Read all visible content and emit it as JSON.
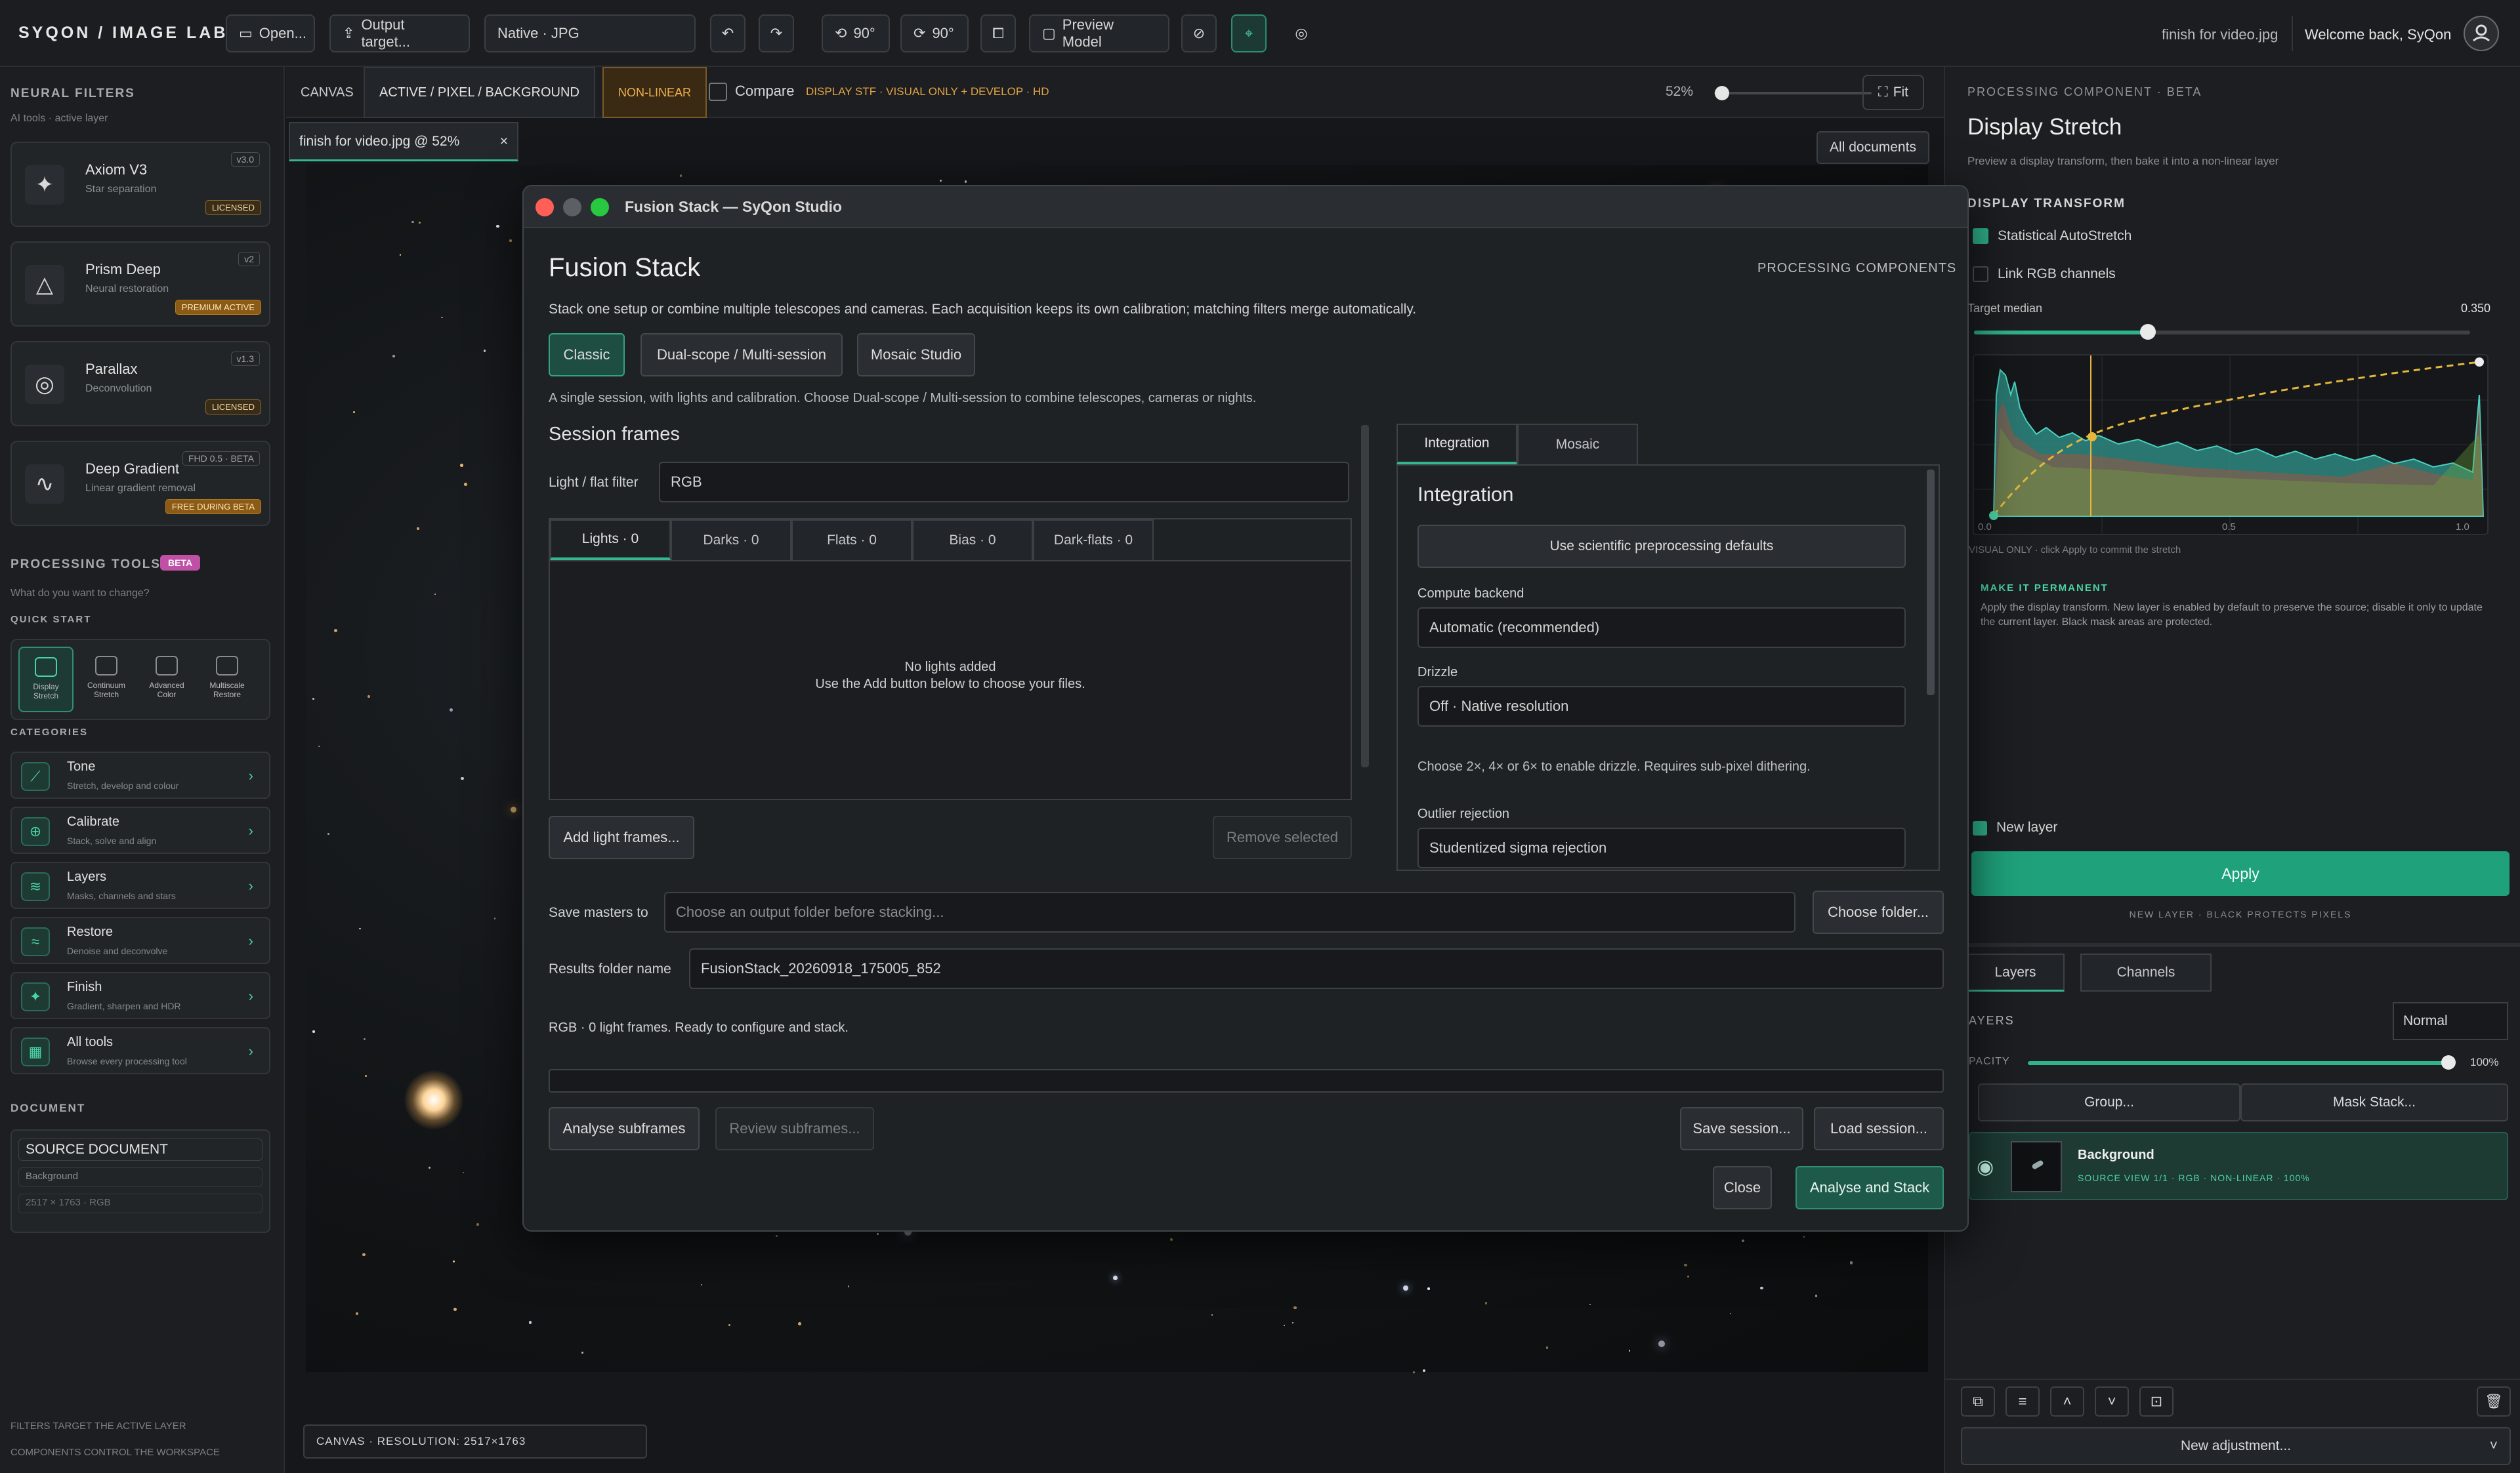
{
  "topbar": {
    "brand": "SYQON / IMAGE LAB",
    "open": "Open...",
    "output_target": "Output target...",
    "format": "Native · JPG",
    "rotate_left": "90°",
    "rotate_right": "90°",
    "preview_model": "Preview Model",
    "filename": "finish for video.jpg",
    "welcome": "Welcome back, SyQon"
  },
  "left": {
    "neural_title": "NEURAL FILTERS",
    "neural_sub": "AI tools · active layer",
    "filters": [
      {
        "name": "Axiom V3",
        "desc": "Star separation",
        "version": "v3.0",
        "badge": "LICENSED"
      },
      {
        "name": "Prism Deep",
        "desc": "Neural restoration",
        "version": "v2",
        "badge": "PREMIUM ACTIVE"
      },
      {
        "name": "Parallax",
        "desc": "Deconvolution",
        "version": "v1.3",
        "badge": "LICENSED"
      },
      {
        "name": "Deep Gradient",
        "desc": "Linear gradient removal",
        "version": "FHD 0.5 · BETA",
        "badge": "FREE DURING BETA"
      }
    ],
    "tools_title": "PROCESSING TOOLS",
    "tools_badge": "BETA",
    "tools_sub": "What do you want to change?",
    "quick_start": "QUICK START",
    "quick": [
      {
        "l1": "Display",
        "l2": "Stretch"
      },
      {
        "l1": "Continuum",
        "l2": "Stretch"
      },
      {
        "l1": "Advanced",
        "l2": "Color"
      },
      {
        "l1": "Multiscale",
        "l2": "Restore"
      }
    ],
    "categories_title": "CATEGORIES",
    "categories": [
      {
        "name": "Tone",
        "desc": "Stretch, develop and colour"
      },
      {
        "name": "Calibrate",
        "desc": "Stack, solve and align"
      },
      {
        "name": "Layers",
        "desc": "Masks, channels and stars"
      },
      {
        "name": "Restore",
        "desc": "Denoise and deconvolve"
      },
      {
        "name": "Finish",
        "desc": "Gradient, sharpen and HDR"
      },
      {
        "name": "All tools",
        "desc": "Browse every processing tool"
      }
    ],
    "document_title": "DOCUMENT",
    "source_document": "SOURCE DOCUMENT",
    "doc_layer": "Background",
    "doc_size": "2517 × 1763  ·  RGB",
    "footer1": "FILTERS TARGET THE ACTIVE LAYER",
    "footer2": "COMPONENTS CONTROL THE WORKSPACE"
  },
  "canvas": {
    "canvas_label": "CANVAS",
    "path": "ACTIVE / PIXEL / BACKGROUND",
    "nonlinear": "NON-LINEAR",
    "compare": "Compare",
    "display_stf": "DISPLAY STF · VISUAL ONLY + DEVELOP · HD",
    "zoom": "52%",
    "zoom_fraction": 0.05,
    "fit": "Fit",
    "doc_tab": "finish for video.jpg @ 52%",
    "all_documents": "All documents",
    "status": "CANVAS  ·  RESOLUTION: 2517×1763"
  },
  "right": {
    "component_label": "PROCESSING COMPONENT · BETA",
    "title": "Display Stretch",
    "subtitle": "Preview a display transform, then bake it into a non-linear layer",
    "transform_title": "DISPLAY TRANSFORM",
    "auto_stretch": "Statistical AutoStretch",
    "link_rgb": "Link RGB channels",
    "target_median": "Target median",
    "target_median_value": "0.350",
    "target_median_fraction": 0.35,
    "axis_ticks": [
      "0.0",
      "0.5",
      "1.0"
    ],
    "visual_only": "VISUAL ONLY · click Apply to commit the stretch",
    "make_permanent": "MAKE IT PERMANENT",
    "permanent_desc": "Apply the display transform. New layer is enabled by default to preserve the source; disable it only to update the current layer. Black mask areas are protected.",
    "new_layer": "New layer",
    "apply": "Apply",
    "new_layer_note": "NEW LAYER · BLACK PROTECTS PIXELS",
    "tab_layers": "Layers",
    "tab_channels": "Channels",
    "layers_title": "AYERS",
    "blend": "Normal",
    "opacity_label": "PACITY",
    "opacity_value": "100%",
    "group": "Group...",
    "mask_stack": "Mask Stack...",
    "layer_name": "Background",
    "layer_meta": "SOURCE VIEW 1/1 · RGB · NON-LINEAR · 100%",
    "new_adjustment": "New adjustment..."
  },
  "dialog": {
    "window_title": "Fusion Stack — SyQon Studio",
    "heading": "Fusion Stack",
    "processing_components": "PROCESSING COMPONENTS",
    "description": "Stack one setup or combine multiple telescopes and cameras. Each acquisition keeps its own calibration; matching filters merge automatically.",
    "modes": [
      "Classic",
      "Dual-scope / Multi-session",
      "Mosaic Studio"
    ],
    "mode_help": "A single session, with lights and calibration. Choose Dual-scope / Multi-session to combine telescopes, cameras or nights.",
    "session_frames": "Session frames",
    "filter_label": "Light / flat filter",
    "filter_value": "RGB",
    "frame_tabs": [
      "Lights · 0",
      "Darks · 0",
      "Flats · 0",
      "Bias · 0",
      "Dark-flats · 0"
    ],
    "empty1": "No lights added",
    "empty2": "Use the Add button below to choose your files.",
    "add_light": "Add light frames...",
    "remove_selected": "Remove selected",
    "right_tabs": [
      "Integration",
      "Mosaic"
    ],
    "integration_title": "Integration",
    "sci_defaults": "Use scientific preprocessing defaults",
    "compute_label": "Compute backend",
    "compute_value": "Automatic (recommended)",
    "drizzle_label": "Drizzle",
    "drizzle_value": "Off · Native resolution",
    "drizzle_help": "Choose 2×, 4× or 6× to enable drizzle. Requires sub-pixel dithering.",
    "outlier_label": "Outlier rejection",
    "outlier_value": "Studentized sigma rejection",
    "save_masters_label": "Save masters to",
    "save_masters_placeholder": "Choose an output folder before stacking...",
    "choose_folder": "Choose folder...",
    "results_label": "Results folder name",
    "results_value": "FusionStack_20260918_175005_852",
    "status": "RGB · 0 light frames. Ready to configure and stack.",
    "progress": 0,
    "analyse": "Analyse subframes",
    "review": "Review subframes...",
    "save_session": "Save session...",
    "load_session": "Load session...",
    "close": "Close",
    "analyse_stack": "Analyse and Stack"
  },
  "colors": {
    "accent": "#2fb38a",
    "beta": "#c04fa6",
    "apply": "#1fa27c",
    "red_light": "#ff5f57",
    "yellow_light": "#5c5f63",
    "green_light": "#28c840"
  }
}
